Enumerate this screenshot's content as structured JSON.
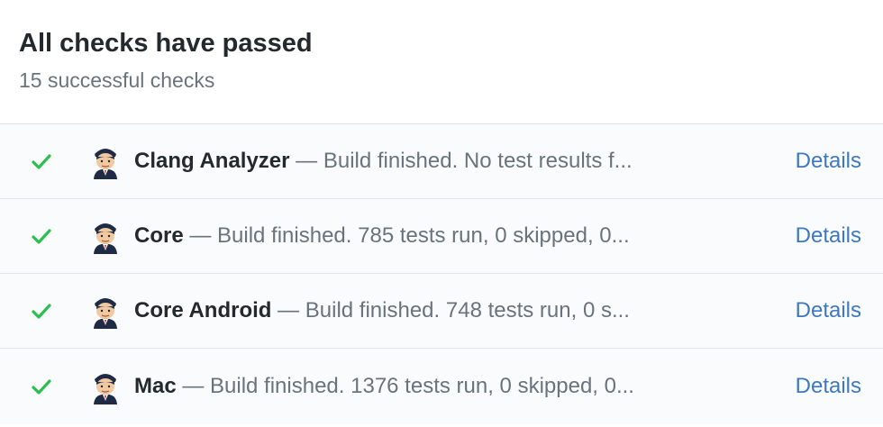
{
  "header": {
    "title": "All checks have passed",
    "subtitle": "15 successful checks"
  },
  "colors": {
    "success": "#2cbe4e",
    "link": "#3d78c0",
    "muted": "#6a737d"
  },
  "checks": [
    {
      "name": "Clang Analyzer",
      "description": " — Build finished. No test results f...",
      "status_icon": "check-icon",
      "avatar_icon": "jenkins-avatar",
      "link_label": "Details"
    },
    {
      "name": "Core",
      "description": " — Build finished. 785 tests run, 0 skipped, 0...",
      "status_icon": "check-icon",
      "avatar_icon": "jenkins-avatar",
      "link_label": "Details"
    },
    {
      "name": "Core Android",
      "description": " — Build finished. 748 tests run, 0 s...",
      "status_icon": "check-icon",
      "avatar_icon": "jenkins-avatar",
      "link_label": "Details"
    },
    {
      "name": "Mac",
      "description": " — Build finished. 1376 tests run, 0 skipped, 0...",
      "status_icon": "check-icon",
      "avatar_icon": "jenkins-avatar",
      "link_label": "Details"
    }
  ]
}
